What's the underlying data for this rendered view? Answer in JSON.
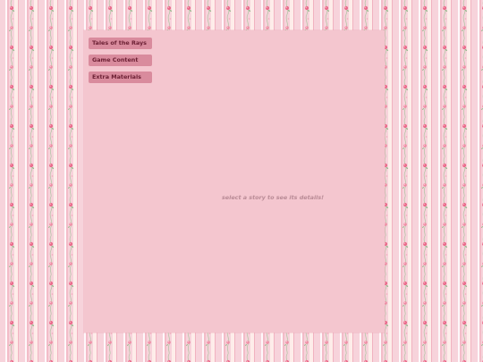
{
  "menu": {
    "items": [
      {
        "label": "Tales of the Rays"
      },
      {
        "label": "Game Content"
      },
      {
        "label": "Extra Materials"
      }
    ]
  },
  "main": {
    "placeholder_text": "select a story to see its details!"
  },
  "colors": {
    "wallpaper_base": "#f7d3db",
    "panel": "#f4c6cf",
    "button": "#d98b9d",
    "button_text": "#6b1f33",
    "hint_text": "#b98b96"
  },
  "icons": {
    "wallpaper_motif": "rose-vine-stripe"
  }
}
